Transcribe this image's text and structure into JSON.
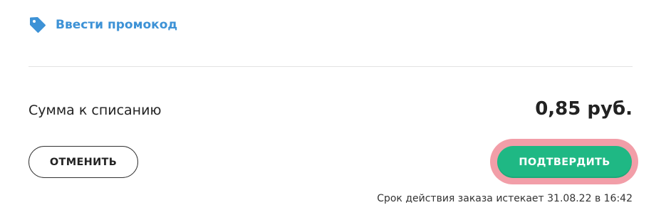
{
  "promo": {
    "label": "Ввести промокод",
    "icon": "tag-icon",
    "color": "#3d92d6"
  },
  "summary": {
    "label": "Сумма к списанию",
    "value": "0,85 руб."
  },
  "actions": {
    "cancel_label": "ОТМЕНИТЬ",
    "confirm_label": "ПОДТВЕРДИТЬ",
    "confirm_color": "#1fb884",
    "confirm_highlight_color": "#f29ea8"
  },
  "expiry": {
    "text": "Срок действия заказа истекает 31.08.22 в 16:42"
  }
}
